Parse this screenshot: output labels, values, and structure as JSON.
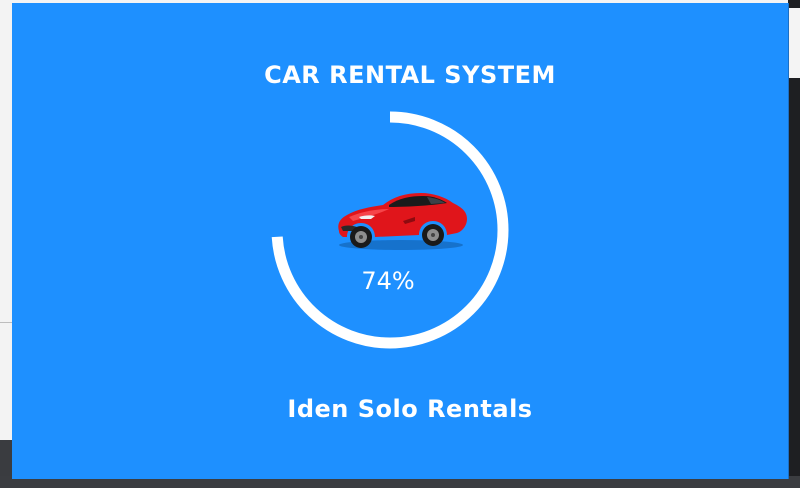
{
  "app": {
    "title": "CAR RENTAL SYSTEM",
    "subtitle": "Iden Solo Rentals"
  },
  "progress": {
    "value": 74,
    "label": "74%"
  },
  "icons": {
    "car": "sports-car-image"
  },
  "colors": {
    "background": "#1e90ff",
    "progress_arc": "#ffffff",
    "text": "#ffffff",
    "car": "#e0151b"
  }
}
